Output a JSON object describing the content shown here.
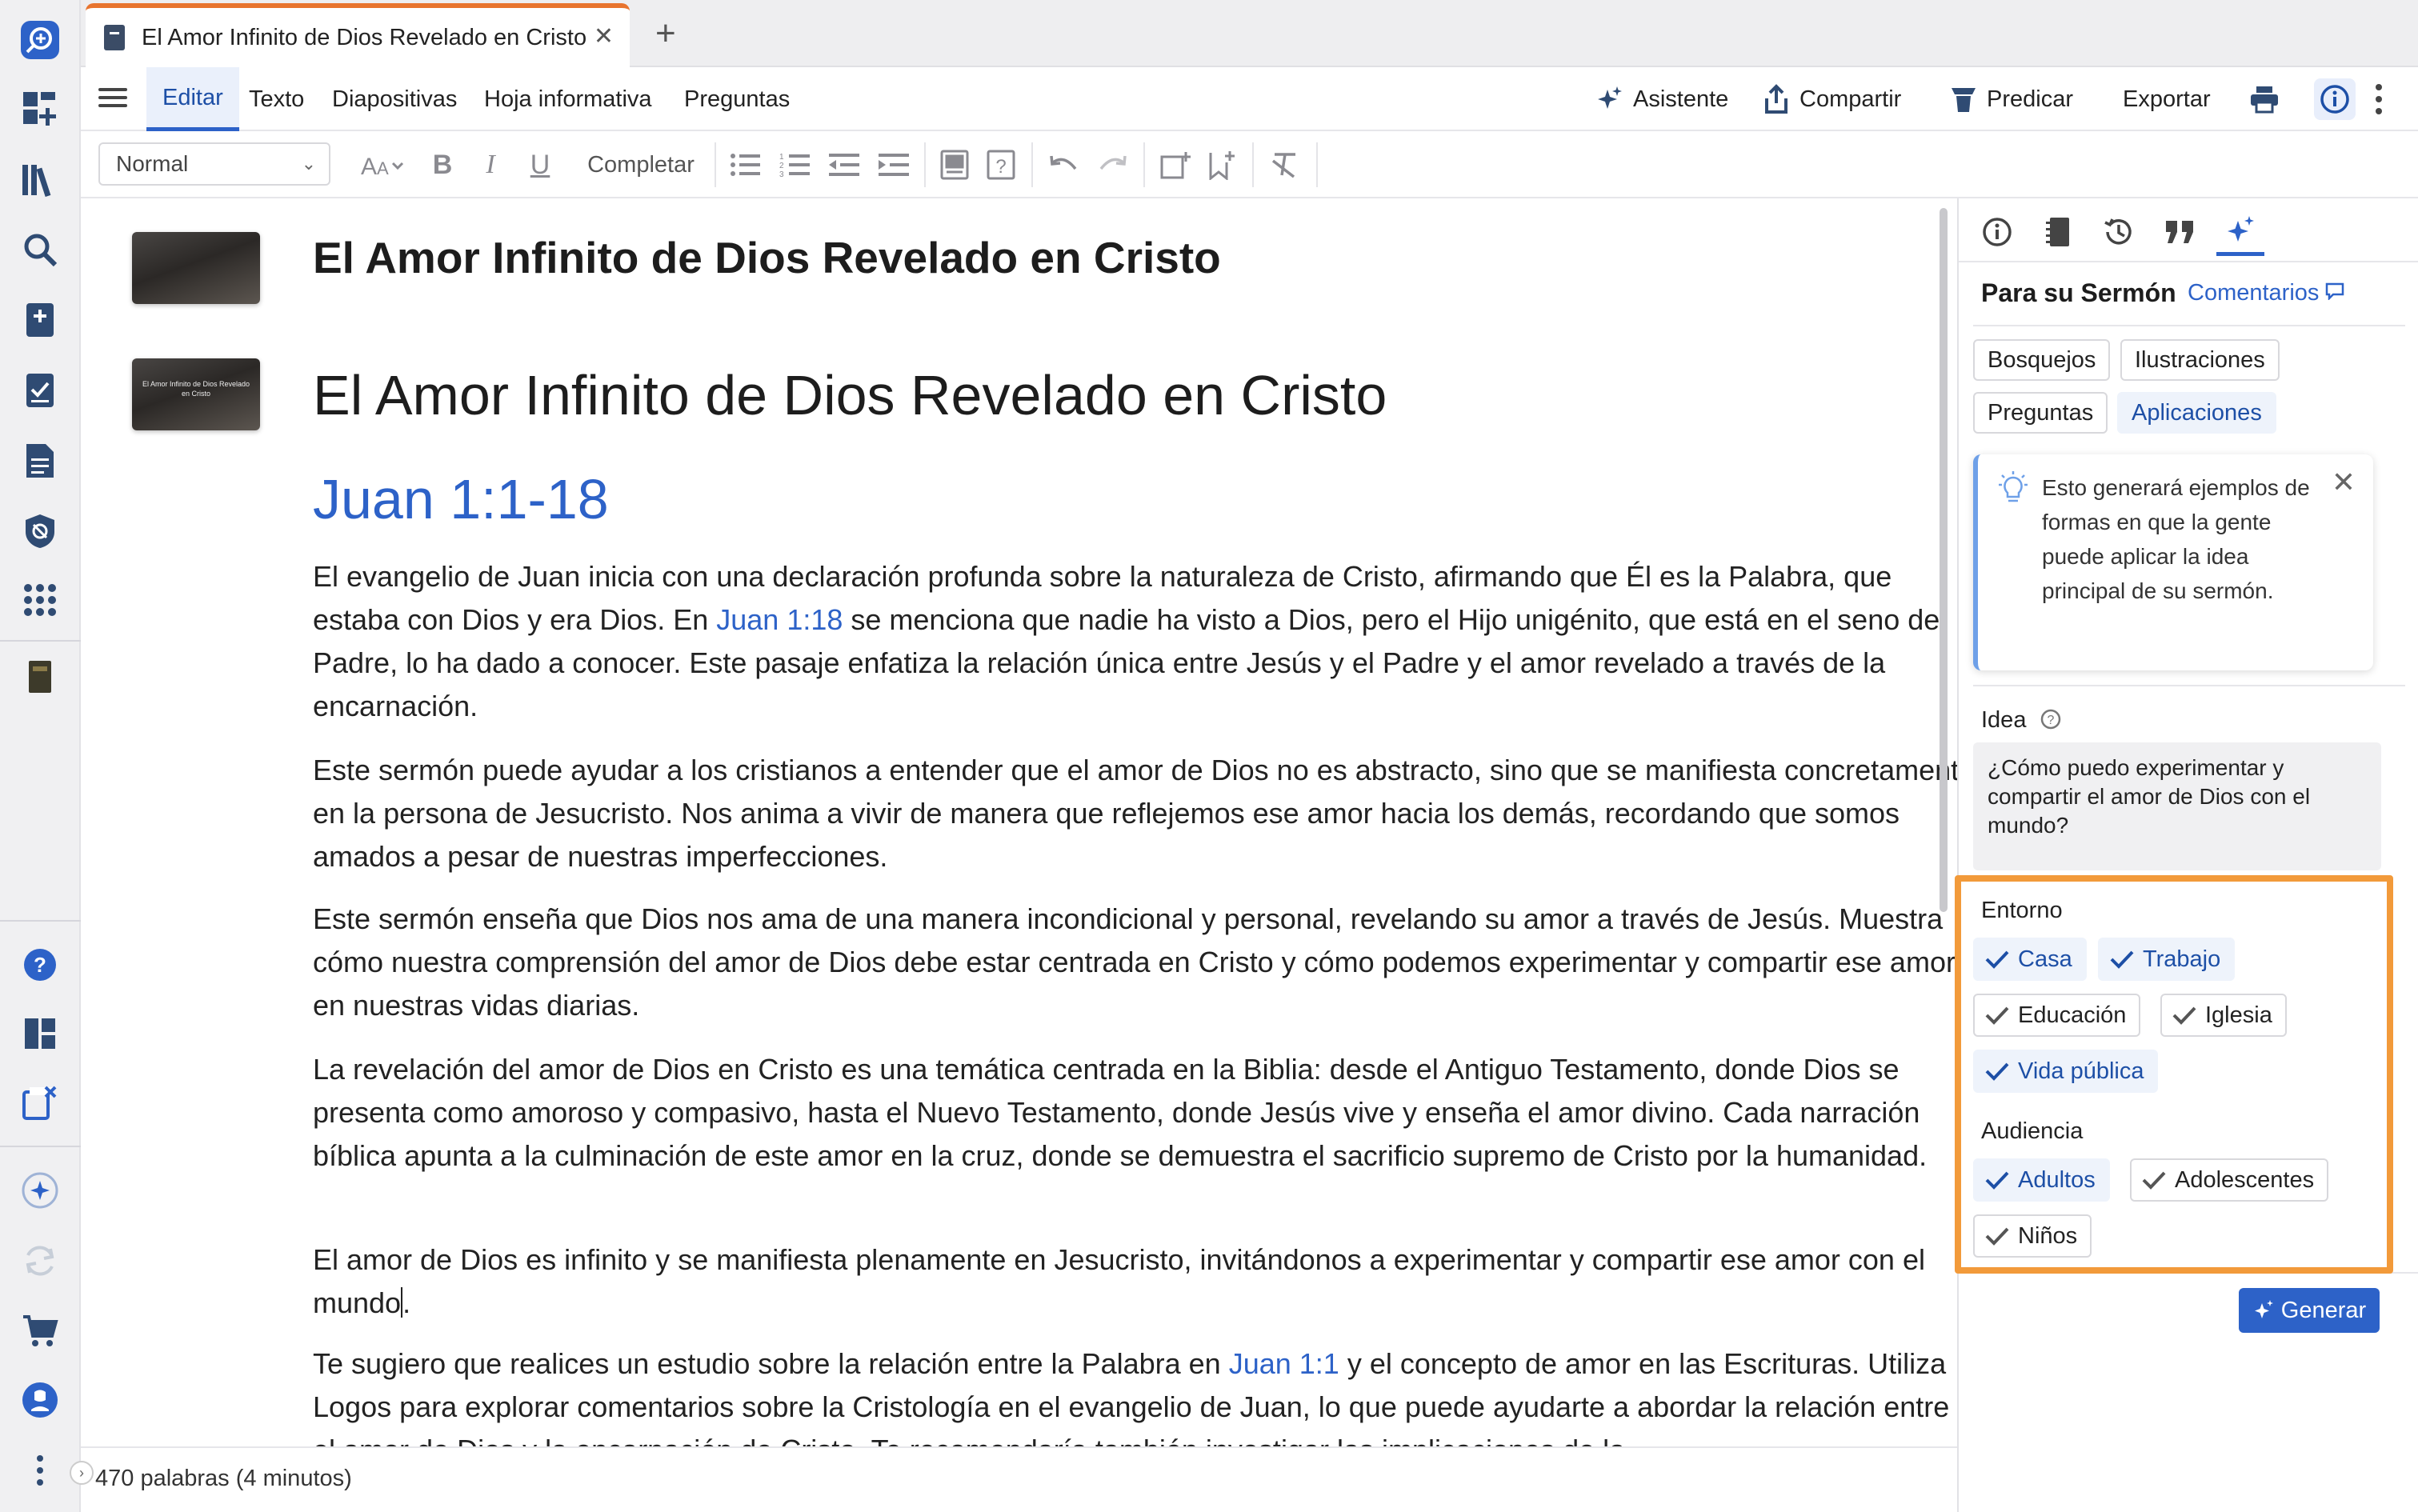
{
  "tab": {
    "title": "El Amor Infinito de Dios Revelado en Cristo",
    "close": "✕",
    "add": "+"
  },
  "menu": {
    "tabs": [
      "Editar",
      "Texto",
      "Diapositivas",
      "Hoja informativa",
      "Preguntas"
    ],
    "asistente": "Asistente",
    "compartir": "Compartir",
    "predicar": "Predicar",
    "exportar": "Exportar"
  },
  "toolbar": {
    "style": "Normal",
    "completar": "Completar"
  },
  "document": {
    "heading1": "El Amor Infinito de Dios Revelado en Cristo",
    "slide_title": "El Amor Infinito de Dios Revelado en Cristo",
    "slide_thumb_text": "El Amor Infinito de Dios Revelado en Cristo",
    "reference": "Juan 1:1-18",
    "p1_a": "El evangelio de Juan inicia con una declaración profunda sobre la naturaleza de Cristo, afirmando que Él es la Palabra, que estaba con Dios y era Dios. En ",
    "p1_link": "Juan 1:18",
    "p1_b": " se menciona que nadie ha visto a Dios, pero el Hijo unigénito, que está en el seno del Padre, lo ha dado a conocer. Este pasaje enfatiza la relación única entre Jesús y el Padre y el amor revelado a través de la encarnación.",
    "p2": "Este sermón puede ayudar a los cristianos a entender que el amor de Dios no es abstracto, sino que se manifiesta concretamente en la persona de Jesucristo. Nos anima a vivir de manera que reflejemos ese amor hacia los demás, recordando que somos amados a pesar de nuestras imperfecciones.",
    "p3": "Este sermón enseña que Dios nos ama de una manera incondicional y personal, revelando su amor a través de Jesús. Muestra cómo nuestra comprensión del amor de Dios debe estar centrada en Cristo y cómo podemos experimentar y compartir ese amor en nuestras vidas diarias.",
    "p4": "La revelación del amor de Dios en Cristo es una temática centrada en la Biblia: desde el Antiguo Testamento, donde Dios se presenta como amoroso y compasivo, hasta el Nuevo Testamento, donde Jesús vive y enseña el amor divino. Cada narración bíblica apunta a la culminación de este amor en la cruz, donde se demuestra el sacrificio supremo de Cristo por la humanidad.",
    "p5_a": "El amor de Dios es infinito y se manifiesta plenamente en Jesucristo, invitándonos a experimentar y compartir ese amor con el mundo",
    "p5_b": ".",
    "p6_a": "Te sugiero que realices un estudio sobre la relación entre la Palabra en ",
    "p6_link": "Juan 1:1",
    "p6_b": " y el concepto de amor en las Escrituras. Utiliza Logos para explorar comentarios sobre la Cristología en el evangelio de Juan, lo que puede ayudarte a abordar la relación entre el amor de Dios y la encarnación de Cristo. Te recomendaría también investigar las implicaciones de la"
  },
  "status": {
    "word_count": "470 palabras (4 minutos)"
  },
  "panel": {
    "title": "Para su Sermón",
    "comments_link": "Comentarios",
    "types": [
      "Bosquejos",
      "Ilustraciones",
      "Preguntas",
      "Aplicaciones"
    ],
    "tip": "Esto generará ejemplos de formas en que la gente puede aplicar la idea principal de su sermón.",
    "idea_label": "Idea",
    "idea_text": "¿Cómo puedo experimentar y compartir el amor de Dios con el mundo?",
    "entorno_label": "Entorno",
    "entorno": [
      {
        "label": "Casa",
        "on": true
      },
      {
        "label": "Trabajo",
        "on": true
      },
      {
        "label": "Educación",
        "on": false
      },
      {
        "label": "Iglesia",
        "on": false
      },
      {
        "label": "Vida pública",
        "on": true
      }
    ],
    "audiencia_label": "Audiencia",
    "audiencia": [
      {
        "label": "Adultos",
        "on": true
      },
      {
        "label": "Adolescentes",
        "on": false
      },
      {
        "label": "Niños",
        "on": false
      }
    ],
    "generate": "Generar"
  },
  "colors": {
    "accent": "#2d62c8",
    "highlight_box": "#f29a3a",
    "tab_accent": "#e8742e"
  }
}
